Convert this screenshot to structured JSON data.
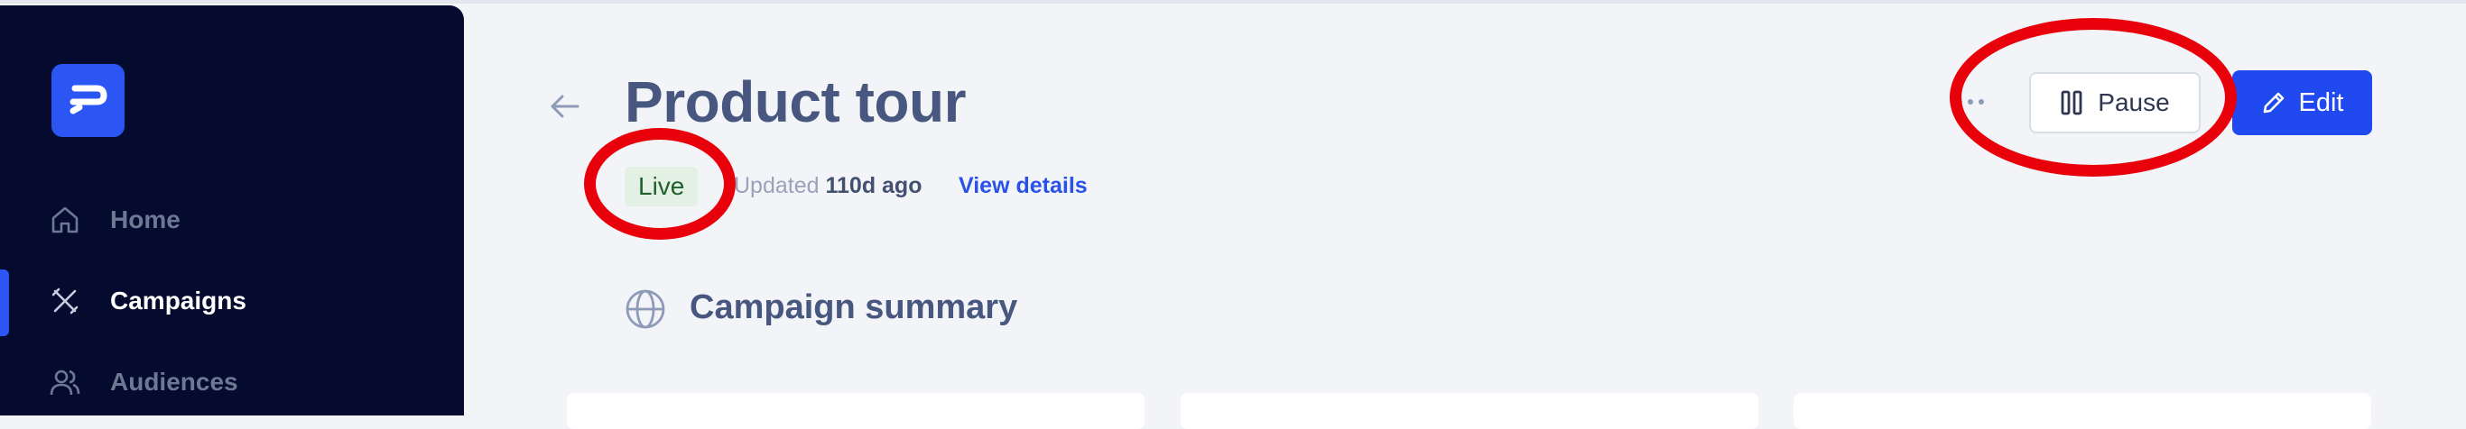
{
  "sidebar": {
    "logo_icon": "brand-logo-icon",
    "items": [
      {
        "label": "Home",
        "icon": "home-icon",
        "active": false
      },
      {
        "label": "Campaigns",
        "icon": "campaigns-icon",
        "active": true
      },
      {
        "label": "Audiences",
        "icon": "audiences-icon",
        "active": false
      }
    ]
  },
  "header": {
    "title": "Product tour",
    "status": "Live",
    "updated_prefix": "Updated",
    "updated_value": "110d ago",
    "view_details": "View details",
    "pause_label": "Pause",
    "edit_label": "Edit"
  },
  "summary": {
    "title": "Campaign summary"
  },
  "colors": {
    "sidebar_bg": "#050a2f",
    "accent": "#2049f0",
    "live_badge_bg": "#e3f1e4",
    "live_badge_text": "#215f2b",
    "annotation": "#e8000b"
  }
}
